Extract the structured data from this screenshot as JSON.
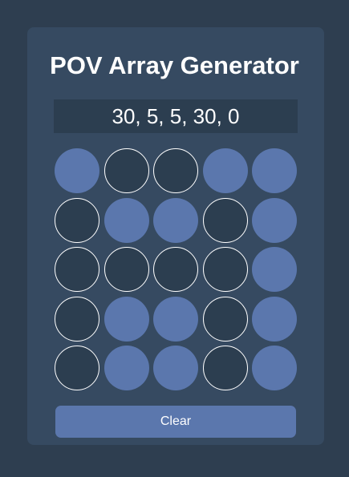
{
  "app": {
    "title": "POV Array Generator"
  },
  "output": {
    "text": "30, 5, 5, 30, 0"
  },
  "grid": {
    "rows": 5,
    "cols": 5,
    "cells": [
      [
        true,
        false,
        false,
        true,
        true
      ],
      [
        false,
        true,
        true,
        false,
        true
      ],
      [
        false,
        false,
        false,
        false,
        true
      ],
      [
        false,
        true,
        true,
        false,
        true
      ],
      [
        false,
        true,
        true,
        false,
        true
      ]
    ]
  },
  "colors": {
    "background": "#2e3e50",
    "card": "#364a61",
    "on": "#5b77ad",
    "off": "#2c3e50",
    "off_border": "#ffffff"
  },
  "buttons": {
    "clear_label": "Clear"
  }
}
